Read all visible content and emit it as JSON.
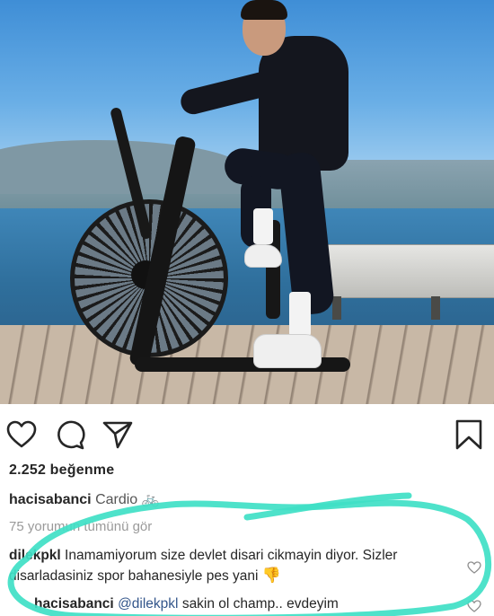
{
  "post": {
    "likes": "2.252 beğenme",
    "caption": {
      "user": "hacisabanci",
      "text": "Cardio 🚲"
    },
    "view_all": "75 yorumun tümünü gör"
  },
  "comments": [
    {
      "user": "dilekpkl",
      "text": "Inamamiyorum size devlet disari cikmayin diyor. Sizler disarladasiniz spor bahanesiyle pes yani",
      "emoji": "👎"
    }
  ],
  "reply": {
    "user": "hacisabanci",
    "mention": "@dilekpkl",
    "text": "sakin ol champ.. evdeyim"
  },
  "icons": {
    "like": "heart-icon",
    "comment": "comment-bubble-icon",
    "share": "paper-plane-icon",
    "save": "bookmark-icon"
  },
  "colors": {
    "highlight_marker": "#3fe0c5",
    "mention": "#34568b",
    "muted": "#9a9a9a"
  }
}
